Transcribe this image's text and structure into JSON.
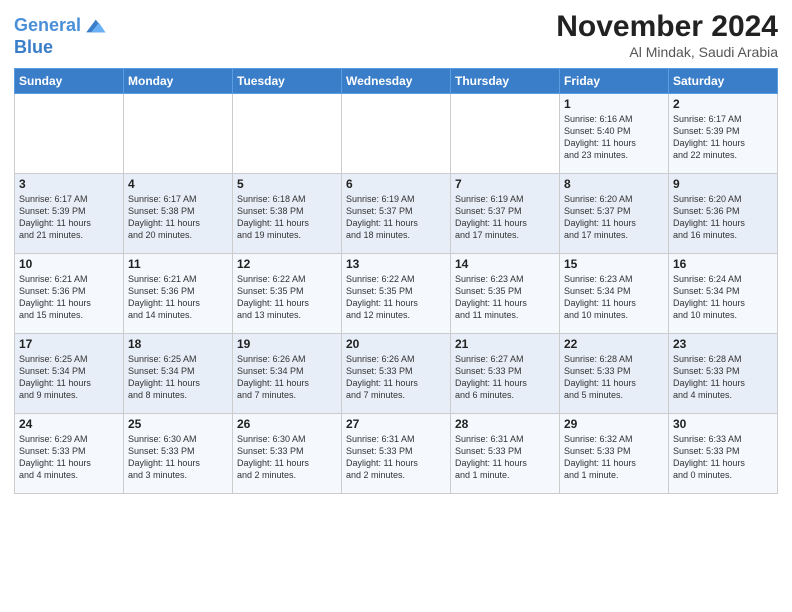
{
  "header": {
    "logo_line1": "General",
    "logo_line2": "Blue",
    "month": "November 2024",
    "location": "Al Mindak, Saudi Arabia"
  },
  "weekdays": [
    "Sunday",
    "Monday",
    "Tuesday",
    "Wednesday",
    "Thursday",
    "Friday",
    "Saturday"
  ],
  "weeks": [
    [
      {
        "day": "",
        "info": ""
      },
      {
        "day": "",
        "info": ""
      },
      {
        "day": "",
        "info": ""
      },
      {
        "day": "",
        "info": ""
      },
      {
        "day": "",
        "info": ""
      },
      {
        "day": "1",
        "info": "Sunrise: 6:16 AM\nSunset: 5:40 PM\nDaylight: 11 hours\nand 23 minutes."
      },
      {
        "day": "2",
        "info": "Sunrise: 6:17 AM\nSunset: 5:39 PM\nDaylight: 11 hours\nand 22 minutes."
      }
    ],
    [
      {
        "day": "3",
        "info": "Sunrise: 6:17 AM\nSunset: 5:39 PM\nDaylight: 11 hours\nand 21 minutes."
      },
      {
        "day": "4",
        "info": "Sunrise: 6:17 AM\nSunset: 5:38 PM\nDaylight: 11 hours\nand 20 minutes."
      },
      {
        "day": "5",
        "info": "Sunrise: 6:18 AM\nSunset: 5:38 PM\nDaylight: 11 hours\nand 19 minutes."
      },
      {
        "day": "6",
        "info": "Sunrise: 6:19 AM\nSunset: 5:37 PM\nDaylight: 11 hours\nand 18 minutes."
      },
      {
        "day": "7",
        "info": "Sunrise: 6:19 AM\nSunset: 5:37 PM\nDaylight: 11 hours\nand 17 minutes."
      },
      {
        "day": "8",
        "info": "Sunrise: 6:20 AM\nSunset: 5:37 PM\nDaylight: 11 hours\nand 17 minutes."
      },
      {
        "day": "9",
        "info": "Sunrise: 6:20 AM\nSunset: 5:36 PM\nDaylight: 11 hours\nand 16 minutes."
      }
    ],
    [
      {
        "day": "10",
        "info": "Sunrise: 6:21 AM\nSunset: 5:36 PM\nDaylight: 11 hours\nand 15 minutes."
      },
      {
        "day": "11",
        "info": "Sunrise: 6:21 AM\nSunset: 5:36 PM\nDaylight: 11 hours\nand 14 minutes."
      },
      {
        "day": "12",
        "info": "Sunrise: 6:22 AM\nSunset: 5:35 PM\nDaylight: 11 hours\nand 13 minutes."
      },
      {
        "day": "13",
        "info": "Sunrise: 6:22 AM\nSunset: 5:35 PM\nDaylight: 11 hours\nand 12 minutes."
      },
      {
        "day": "14",
        "info": "Sunrise: 6:23 AM\nSunset: 5:35 PM\nDaylight: 11 hours\nand 11 minutes."
      },
      {
        "day": "15",
        "info": "Sunrise: 6:23 AM\nSunset: 5:34 PM\nDaylight: 11 hours\nand 10 minutes."
      },
      {
        "day": "16",
        "info": "Sunrise: 6:24 AM\nSunset: 5:34 PM\nDaylight: 11 hours\nand 10 minutes."
      }
    ],
    [
      {
        "day": "17",
        "info": "Sunrise: 6:25 AM\nSunset: 5:34 PM\nDaylight: 11 hours\nand 9 minutes."
      },
      {
        "day": "18",
        "info": "Sunrise: 6:25 AM\nSunset: 5:34 PM\nDaylight: 11 hours\nand 8 minutes."
      },
      {
        "day": "19",
        "info": "Sunrise: 6:26 AM\nSunset: 5:34 PM\nDaylight: 11 hours\nand 7 minutes."
      },
      {
        "day": "20",
        "info": "Sunrise: 6:26 AM\nSunset: 5:33 PM\nDaylight: 11 hours\nand 7 minutes."
      },
      {
        "day": "21",
        "info": "Sunrise: 6:27 AM\nSunset: 5:33 PM\nDaylight: 11 hours\nand 6 minutes."
      },
      {
        "day": "22",
        "info": "Sunrise: 6:28 AM\nSunset: 5:33 PM\nDaylight: 11 hours\nand 5 minutes."
      },
      {
        "day": "23",
        "info": "Sunrise: 6:28 AM\nSunset: 5:33 PM\nDaylight: 11 hours\nand 4 minutes."
      }
    ],
    [
      {
        "day": "24",
        "info": "Sunrise: 6:29 AM\nSunset: 5:33 PM\nDaylight: 11 hours\nand 4 minutes."
      },
      {
        "day": "25",
        "info": "Sunrise: 6:30 AM\nSunset: 5:33 PM\nDaylight: 11 hours\nand 3 minutes."
      },
      {
        "day": "26",
        "info": "Sunrise: 6:30 AM\nSunset: 5:33 PM\nDaylight: 11 hours\nand 2 minutes."
      },
      {
        "day": "27",
        "info": "Sunrise: 6:31 AM\nSunset: 5:33 PM\nDaylight: 11 hours\nand 2 minutes."
      },
      {
        "day": "28",
        "info": "Sunrise: 6:31 AM\nSunset: 5:33 PM\nDaylight: 11 hours\nand 1 minute."
      },
      {
        "day": "29",
        "info": "Sunrise: 6:32 AM\nSunset: 5:33 PM\nDaylight: 11 hours\nand 1 minute."
      },
      {
        "day": "30",
        "info": "Sunrise: 6:33 AM\nSunset: 5:33 PM\nDaylight: 11 hours\nand 0 minutes."
      }
    ]
  ]
}
